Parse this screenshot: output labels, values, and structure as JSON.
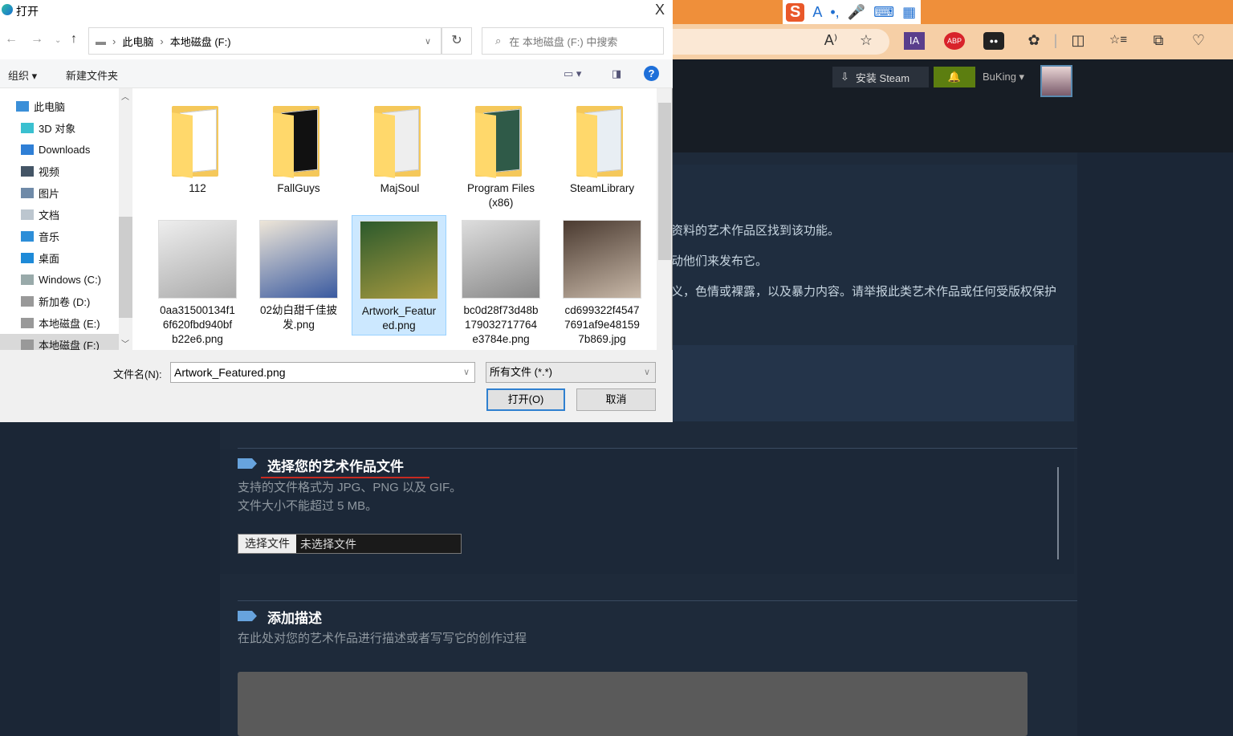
{
  "browser": {
    "ime_logo": "S",
    "ime_items": [
      "A",
      "•,",
      "🎤",
      "⌨",
      "▦"
    ],
    "extensions": [
      "A⁾",
      "☆",
      "IA",
      "ABP",
      "●●",
      "✿",
      "|",
      "◫",
      "☆≡",
      "⧉",
      "♡"
    ]
  },
  "steam_header": {
    "install": "安装 Steam",
    "username": "BuKing",
    "bell": "🔔"
  },
  "page": {
    "intro_lines": [
      "资料的艺术作品区找到该功能。",
      "动他们来发布它。",
      "义，色情或裸露，以及暴力内容。请举报此类艺术作品或任何受版权保护"
    ],
    "section1": {
      "title": "选择您的艺术作品文件",
      "desc1": "支持的文件格式为 JPG、PNG 以及 GIF。",
      "desc2": "文件大小不能超过 5 MB。",
      "choose_button": "选择文件",
      "file_status": "未选择文件"
    },
    "section2": {
      "title": "添加描述",
      "desc": "在此处对您的艺术作品进行描述或者写写它的创作过程"
    }
  },
  "dialog": {
    "title": "打开",
    "close": "X",
    "breadcrumb": [
      "此电脑",
      "本地磁盘 (F:)"
    ],
    "search_placeholder": "在 本地磁盘 (F:) 中搜索",
    "organize": "组织 ▾",
    "new_folder": "新建文件夹",
    "help": "?",
    "tree": [
      {
        "label": "此电脑",
        "color": "#3b8fd8"
      },
      {
        "label": "3D 对象",
        "color": "#3ac0d0"
      },
      {
        "label": "Downloads",
        "color": "#2f7fd6"
      },
      {
        "label": "视频",
        "color": "#445566"
      },
      {
        "label": "图片",
        "color": "#6f8aa8"
      },
      {
        "label": "文档",
        "color": "#bcc6cf"
      },
      {
        "label": "音乐",
        "color": "#2d8ed8"
      },
      {
        "label": "桌面",
        "color": "#1e8ad8"
      },
      {
        "label": "Windows (C:)",
        "color": "#9aa"
      },
      {
        "label": "新加卷 (D:)",
        "color": "#999"
      },
      {
        "label": "本地磁盘 (E:)",
        "color": "#999"
      },
      {
        "label": "本地磁盘 (F:)",
        "color": "#999",
        "selected": true
      }
    ],
    "folders": [
      {
        "name": "112",
        "doc": "#fff"
      },
      {
        "name": "FallGuys",
        "doc": "#111"
      },
      {
        "name": "MajSoul",
        "doc": "#eee"
      },
      {
        "name": "Program Files (x86)",
        "doc": "#2f5a48"
      },
      {
        "name": "SteamLibrary",
        "doc": "#e8eef3"
      }
    ],
    "files": [
      {
        "name": "0aa31500134f16f620fbd940bfb22e6.png",
        "lines": [
          "0aa31500134f1",
          "6f620fbd940bf",
          "b22e6.png"
        ],
        "colors": [
          "#eee",
          "#aaa"
        ]
      },
      {
        "name": "02幼白甜千佳披发.png",
        "lines": [
          "02幼白甜千佳披",
          "发.png"
        ],
        "colors": [
          "#eee6d8",
          "#3a5aa0"
        ]
      },
      {
        "name": "Artwork_Featured.png",
        "lines": [
          "Artwork_Featur",
          "ed.png"
        ],
        "colors": [
          "#2c5a2c",
          "#a89a40"
        ],
        "selected": true
      },
      {
        "name": "bc0d28f73d48b179032717764e3784e.png",
        "lines": [
          "bc0d28f73d48b",
          "179032717764",
          "e3784e.png"
        ],
        "colors": [
          "#ddd",
          "#888"
        ]
      },
      {
        "name": "cd699322f45477691af9e481597b869.jpg",
        "lines": [
          "cd699322f4547",
          "7691af9e48159",
          "7b869.jpg"
        ],
        "colors": [
          "#4a3a30",
          "#c8b8a8"
        ]
      }
    ],
    "filename_label": "文件名(N):",
    "filename_value": "Artwork_Featured.png",
    "filetype": "所有文件 (*.*)",
    "open_button": "打开(O)",
    "cancel_button": "取消"
  }
}
